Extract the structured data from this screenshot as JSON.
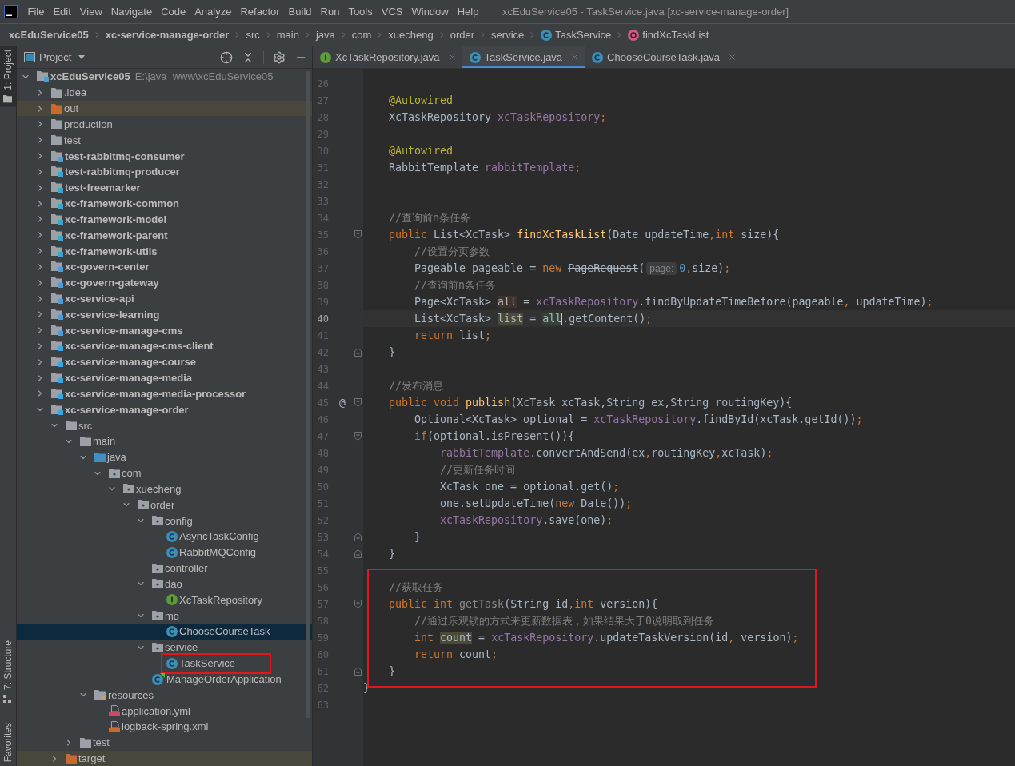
{
  "menu_bar": {
    "items": [
      "File",
      "Edit",
      "View",
      "Navigate",
      "Code",
      "Analyze",
      "Refactor",
      "Build",
      "Run",
      "Tools",
      "VCS",
      "Window",
      "Help"
    ],
    "title": "xcEduService05 - TaskService.java [xc-service-manage-order]"
  },
  "breadcrumbs": [
    {
      "label": "xcEduService05",
      "kind": "module"
    },
    {
      "label": "xc-service-manage-order",
      "kind": "module"
    },
    {
      "label": "src",
      "kind": "folder"
    },
    {
      "label": "main",
      "kind": "folder"
    },
    {
      "label": "java",
      "kind": "folder"
    },
    {
      "label": "com",
      "kind": "folder"
    },
    {
      "label": "xuecheng",
      "kind": "folder"
    },
    {
      "label": "order",
      "kind": "folder"
    },
    {
      "label": "service",
      "kind": "folder"
    },
    {
      "label": "TaskService",
      "kind": "class"
    },
    {
      "label": "findXcTaskList",
      "kind": "method"
    }
  ],
  "tool_stripe": {
    "top": [
      {
        "label": "1: Project",
        "kind": "project",
        "selected": true
      }
    ],
    "bottom": [
      {
        "label": "7: Structure",
        "kind": "structure",
        "selected": false
      },
      {
        "label": "Favorites",
        "kind": "favorites",
        "selected": false
      }
    ]
  },
  "project_panel": {
    "title": "Project",
    "tree": [
      {
        "name": "xcEduService05",
        "path": "E:\\java_www\\xcEduService05",
        "kind": "module",
        "expanded": true,
        "selected": false,
        "boxed": false,
        "children": [
          {
            "name": ".idea",
            "kind": "folder",
            "expanded": false,
            "selected": false,
            "boxed": false
          },
          {
            "name": "out",
            "kind": "excluded",
            "expanded": false,
            "selected": false,
            "boxed": false
          },
          {
            "name": "production",
            "kind": "folder",
            "expanded": false,
            "selected": false,
            "boxed": false
          },
          {
            "name": "test",
            "kind": "folder",
            "expanded": false,
            "selected": false,
            "boxed": false
          },
          {
            "name": "test-rabbitmq-consumer",
            "kind": "module",
            "expanded": false,
            "selected": false,
            "boxed": false
          },
          {
            "name": "test-rabbitmq-producer",
            "kind": "module",
            "expanded": false,
            "selected": false,
            "boxed": false
          },
          {
            "name": "test-freemarker",
            "kind": "module",
            "expanded": false,
            "selected": false,
            "boxed": false
          },
          {
            "name": "xc-framework-common",
            "kind": "module",
            "expanded": false,
            "selected": false,
            "boxed": false
          },
          {
            "name": "xc-framework-model",
            "kind": "module",
            "expanded": false,
            "selected": false,
            "boxed": false
          },
          {
            "name": "xc-framework-parent",
            "kind": "module",
            "expanded": false,
            "selected": false,
            "boxed": false
          },
          {
            "name": "xc-framework-utils",
            "kind": "module",
            "expanded": false,
            "selected": false,
            "boxed": false
          },
          {
            "name": "xc-govern-center",
            "kind": "module",
            "expanded": false,
            "selected": false,
            "boxed": false
          },
          {
            "name": "xc-govern-gateway",
            "kind": "module",
            "expanded": false,
            "selected": false,
            "boxed": false
          },
          {
            "name": "xc-service-api",
            "kind": "module",
            "expanded": false,
            "selected": false,
            "boxed": false
          },
          {
            "name": "xc-service-learning",
            "kind": "module",
            "expanded": false,
            "selected": false,
            "boxed": false
          },
          {
            "name": "xc-service-manage-cms",
            "kind": "module",
            "expanded": false,
            "selected": false,
            "boxed": false
          },
          {
            "name": "xc-service-manage-cms-client",
            "kind": "module",
            "expanded": false,
            "selected": false,
            "boxed": false
          },
          {
            "name": "xc-service-manage-course",
            "kind": "module",
            "expanded": false,
            "selected": false,
            "boxed": false
          },
          {
            "name": "xc-service-manage-media",
            "kind": "module",
            "expanded": false,
            "selected": false,
            "boxed": false
          },
          {
            "name": "xc-service-manage-media-processor",
            "kind": "module",
            "expanded": false,
            "selected": false,
            "boxed": false
          },
          {
            "name": "xc-service-manage-order",
            "kind": "module",
            "expanded": true,
            "selected": false,
            "boxed": false,
            "children": [
              {
                "name": "src",
                "kind": "folder",
                "expanded": true,
                "selected": false,
                "boxed": false,
                "children": [
                  {
                    "name": "main",
                    "kind": "folder",
                    "expanded": true,
                    "selected": false,
                    "boxed": false,
                    "children": [
                      {
                        "name": "java",
                        "kind": "source",
                        "expanded": true,
                        "selected": false,
                        "boxed": false,
                        "children": [
                          {
                            "name": "com",
                            "kind": "package",
                            "expanded": true,
                            "selected": false,
                            "boxed": false,
                            "children": [
                              {
                                "name": "xuecheng",
                                "kind": "package",
                                "expanded": true,
                                "selected": false,
                                "boxed": false,
                                "children": [
                                  {
                                    "name": "order",
                                    "kind": "package",
                                    "expanded": true,
                                    "selected": false,
                                    "boxed": false,
                                    "children": [
                                      {
                                        "name": "config",
                                        "kind": "package",
                                        "expanded": true,
                                        "selected": false,
                                        "boxed": false,
                                        "children": [
                                          {
                                            "name": "AsyncTaskConfig",
                                            "kind": "class",
                                            "selected": false,
                                            "boxed": false
                                          },
                                          {
                                            "name": "RabbitMQConfig",
                                            "kind": "class",
                                            "selected": false,
                                            "boxed": false
                                          }
                                        ]
                                      },
                                      {
                                        "name": "controller",
                                        "kind": "package",
                                        "selected": false,
                                        "boxed": false
                                      },
                                      {
                                        "name": "dao",
                                        "kind": "package",
                                        "expanded": true,
                                        "selected": false,
                                        "boxed": false,
                                        "children": [
                                          {
                                            "name": "XcTaskRepository",
                                            "kind": "interface",
                                            "selected": false,
                                            "boxed": false
                                          }
                                        ]
                                      },
                                      {
                                        "name": "mq",
                                        "kind": "package",
                                        "expanded": true,
                                        "selected": false,
                                        "boxed": false,
                                        "children": [
                                          {
                                            "name": "ChooseCourseTask",
                                            "kind": "class",
                                            "selected": true,
                                            "boxed": false
                                          }
                                        ]
                                      },
                                      {
                                        "name": "service",
                                        "kind": "package",
                                        "expanded": true,
                                        "selected": false,
                                        "boxed": false,
                                        "children": [
                                          {
                                            "name": "TaskService",
                                            "kind": "class",
                                            "selected": false,
                                            "boxed": true
                                          }
                                        ]
                                      },
                                      {
                                        "name": "ManageOrderApplication",
                                        "kind": "app",
                                        "selected": false,
                                        "boxed": false
                                      }
                                    ]
                                  }
                                ]
                              }
                            ]
                          }
                        ]
                      },
                      {
                        "name": "resources",
                        "kind": "resources",
                        "expanded": true,
                        "selected": false,
                        "boxed": false,
                        "children": [
                          {
                            "name": "application.yml",
                            "kind": "yml",
                            "selected": false,
                            "boxed": false
                          },
                          {
                            "name": "logback-spring.xml",
                            "kind": "xml",
                            "selected": false,
                            "boxed": false
                          }
                        ]
                      }
                    ]
                  },
                  {
                    "name": "test",
                    "kind": "folder",
                    "expanded": false,
                    "selected": false,
                    "boxed": false
                  }
                ]
              },
              {
                "name": "target",
                "kind": "excluded",
                "expanded": false,
                "selected": false,
                "boxed": false
              }
            ]
          }
        ]
      }
    ]
  },
  "editor": {
    "tabs": [
      {
        "label": "XcTaskRepository.java",
        "kind": "interface",
        "selected": false
      },
      {
        "label": "TaskService.java",
        "kind": "class",
        "selected": true
      },
      {
        "label": "ChooseCourseTask.java",
        "kind": "class",
        "selected": false
      }
    ],
    "lines": [
      {
        "number": "26",
        "current": false,
        "boxed": false
      },
      {
        "number": "27",
        "current": false,
        "boxed": false,
        "tokens": [
          {
            "text": "    @Autowired",
            "kind": "annotation"
          }
        ]
      },
      {
        "number": "28",
        "current": false,
        "boxed": false,
        "tokens": [
          {
            "text": "    XcTaskRepository ",
            "kind": "plain"
          },
          {
            "text": "xcTaskRepository",
            "kind": "field"
          },
          {
            "text": ";",
            "kind": "keyword"
          }
        ]
      },
      {
        "number": "29",
        "current": false,
        "boxed": false
      },
      {
        "number": "30",
        "current": false,
        "boxed": false,
        "tokens": [
          {
            "text": "    @Autowired",
            "kind": "annotation"
          }
        ]
      },
      {
        "number": "31",
        "current": false,
        "boxed": false,
        "tokens": [
          {
            "text": "    RabbitTemplate ",
            "kind": "plain"
          },
          {
            "text": "rabbitTemplate",
            "kind": "field"
          },
          {
            "text": ";",
            "kind": "keyword"
          }
        ]
      },
      {
        "number": "32",
        "current": false,
        "boxed": false
      },
      {
        "number": "33",
        "current": false,
        "boxed": false
      },
      {
        "number": "34",
        "current": false,
        "boxed": false,
        "tokens": [
          {
            "text": "    //查询前n条任务",
            "kind": "comment"
          }
        ]
      },
      {
        "number": "35",
        "current": false,
        "boxed": false,
        "fold": {
          "kind": "start"
        },
        "tokens": [
          {
            "text": "    public ",
            "kind": "keyword"
          },
          {
            "text": "List<XcTask> ",
            "kind": "plain"
          },
          {
            "text": "findXcTaskList",
            "kind": "method"
          },
          {
            "text": "(Date updateTime",
            "kind": "plain"
          },
          {
            "text": ",int ",
            "kind": "keyword"
          },
          {
            "text": "size){",
            "kind": "plain"
          }
        ]
      },
      {
        "number": "36",
        "current": false,
        "boxed": false,
        "tokens": [
          {
            "text": "        //设置分页参数",
            "kind": "comment"
          }
        ]
      },
      {
        "number": "37",
        "current": false,
        "boxed": false,
        "tokens": [
          {
            "text": "        Pageable pageable = ",
            "kind": "plain"
          },
          {
            "text": "new ",
            "kind": "keyword"
          },
          {
            "text": "PageRequest",
            "kind": "deprecated"
          },
          {
            "text": "(",
            "kind": "plain"
          },
          {
            "text": "page:",
            "kind": "hint"
          },
          {
            "text": "0",
            "kind": "number"
          },
          {
            "text": ",",
            "kind": "keyword"
          },
          {
            "text": "size)",
            "kind": "plain"
          },
          {
            "text": ";",
            "kind": "keyword"
          }
        ]
      },
      {
        "number": "38",
        "current": false,
        "boxed": false,
        "tokens": [
          {
            "text": "        //查询前n条任务",
            "kind": "comment"
          }
        ]
      },
      {
        "number": "39",
        "current": false,
        "boxed": false,
        "tokens": [
          {
            "text": "        Page<XcTask> ",
            "kind": "plain"
          },
          {
            "text": "all",
            "kind": "plain",
            "usage": {
              "kind": "write"
            }
          },
          {
            "text": " = ",
            "kind": "plain"
          },
          {
            "text": "xcTaskRepository",
            "kind": "field"
          },
          {
            "text": ".findByUpdateTimeBefore(pageable",
            "kind": "plain"
          },
          {
            "text": ",",
            "kind": "keyword"
          },
          {
            "text": " updateTime)",
            "kind": "plain"
          },
          {
            "text": ";",
            "kind": "keyword"
          }
        ]
      },
      {
        "number": "40",
        "current": true,
        "boxed": false,
        "tokens": [
          {
            "text": "        List<XcTask> ",
            "kind": "plain"
          },
          {
            "text": "list",
            "kind": "plain",
            "usage": {
              "kind": "warning"
            }
          },
          {
            "text": " = ",
            "kind": "plain"
          },
          {
            "text": "all",
            "kind": "plain",
            "usage": {
              "kind": "read"
            },
            "caret": true
          },
          {
            "text": ".getContent()",
            "kind": "plain"
          },
          {
            "text": ";",
            "kind": "keyword"
          }
        ]
      },
      {
        "number": "41",
        "current": false,
        "boxed": false,
        "tokens": [
          {
            "text": "        return ",
            "kind": "keyword"
          },
          {
            "text": "list",
            "kind": "plain"
          },
          {
            "text": ";",
            "kind": "keyword"
          }
        ]
      },
      {
        "number": "42",
        "current": false,
        "boxed": false,
        "fold": {
          "kind": "end"
        },
        "tokens": [
          {
            "text": "    }",
            "kind": "plain"
          }
        ]
      },
      {
        "number": "43",
        "current": false,
        "boxed": false
      },
      {
        "number": "44",
        "current": false,
        "boxed": false,
        "tokens": [
          {
            "text": "    //发布消息",
            "kind": "comment"
          }
        ]
      },
      {
        "number": "45",
        "current": false,
        "boxed": false,
        "fold": {
          "kind": "start"
        },
        "gutter_mark": "@",
        "tokens": [
          {
            "text": "    public void ",
            "kind": "keyword"
          },
          {
            "text": "publish",
            "kind": "method"
          },
          {
            "text": "(XcTask xcTask,String ex,String routingKey){",
            "kind": "plain"
          }
        ]
      },
      {
        "number": "46",
        "current": false,
        "boxed": false,
        "tokens": [
          {
            "text": "        Optional<XcTask> optional = ",
            "kind": "plain"
          },
          {
            "text": "xcTaskRepository",
            "kind": "field"
          },
          {
            "text": ".findById(xcTask.getId())",
            "kind": "plain"
          },
          {
            "text": ";",
            "kind": "keyword"
          }
        ]
      },
      {
        "number": "47",
        "current": false,
        "boxed": false,
        "fold": {
          "kind": "start"
        },
        "tokens": [
          {
            "text": "        if",
            "kind": "keyword"
          },
          {
            "text": "(optional.isPresent()){",
            "kind": "plain"
          }
        ]
      },
      {
        "number": "48",
        "current": false,
        "boxed": false,
        "tokens": [
          {
            "text": "            rabbitTemplate",
            "kind": "field"
          },
          {
            "text": ".convertAndSend(ex",
            "kind": "plain"
          },
          {
            "text": ",",
            "kind": "keyword"
          },
          {
            "text": "routingKey",
            "kind": "plain"
          },
          {
            "text": ",",
            "kind": "keyword"
          },
          {
            "text": "xcTask)",
            "kind": "plain"
          },
          {
            "text": ";",
            "kind": "keyword"
          }
        ]
      },
      {
        "number": "49",
        "current": false,
        "boxed": false,
        "tokens": [
          {
            "text": "            //更新任务时间",
            "kind": "comment"
          }
        ]
      },
      {
        "number": "50",
        "current": false,
        "boxed": false,
        "tokens": [
          {
            "text": "            XcTask one = optional.get()",
            "kind": "plain"
          },
          {
            "text": ";",
            "kind": "keyword"
          }
        ]
      },
      {
        "number": "51",
        "current": false,
        "boxed": false,
        "tokens": [
          {
            "text": "            one.setUpdateTime(",
            "kind": "plain"
          },
          {
            "text": "new ",
            "kind": "keyword"
          },
          {
            "text": "Date())",
            "kind": "plain"
          },
          {
            "text": ";",
            "kind": "keyword"
          }
        ]
      },
      {
        "number": "52",
        "current": false,
        "boxed": false,
        "tokens": [
          {
            "text": "            xcTaskRepository",
            "kind": "field"
          },
          {
            "text": ".save(one)",
            "kind": "plain"
          },
          {
            "text": ";",
            "kind": "keyword"
          }
        ]
      },
      {
        "number": "53",
        "current": false,
        "boxed": false,
        "fold": {
          "kind": "end"
        },
        "tokens": [
          {
            "text": "        }",
            "kind": "plain"
          }
        ]
      },
      {
        "number": "54",
        "current": false,
        "boxed": false,
        "fold": {
          "kind": "end"
        },
        "tokens": [
          {
            "text": "    }",
            "kind": "plain"
          }
        ]
      },
      {
        "number": "55",
        "current": false,
        "boxed": false
      },
      {
        "number": "56",
        "current": false,
        "boxed": true,
        "tokens": [
          {
            "text": "    //获取任务",
            "kind": "comment"
          }
        ]
      },
      {
        "number": "57",
        "current": false,
        "boxed": true,
        "fold": {
          "kind": "start"
        },
        "tokens": [
          {
            "text": "    public int ",
            "kind": "keyword"
          },
          {
            "text": "getTask",
            "kind": "unused"
          },
          {
            "text": "(String id",
            "kind": "plain"
          },
          {
            "text": ",int ",
            "kind": "keyword"
          },
          {
            "text": "version){",
            "kind": "plain"
          }
        ]
      },
      {
        "number": "58",
        "current": false,
        "boxed": true,
        "tokens": [
          {
            "text": "        //通过乐观锁的方式来更新数据表，如果结果大于0说明取到任务",
            "kind": "comment"
          }
        ]
      },
      {
        "number": "59",
        "current": false,
        "boxed": true,
        "tokens": [
          {
            "text": "        int ",
            "kind": "keyword"
          },
          {
            "text": "count",
            "kind": "plain",
            "usage": {
              "kind": "warning"
            }
          },
          {
            "text": " = ",
            "kind": "plain"
          },
          {
            "text": "xcTaskRepository",
            "kind": "field"
          },
          {
            "text": ".updateTaskVersion(id",
            "kind": "plain"
          },
          {
            "text": ",",
            "kind": "keyword"
          },
          {
            "text": " version)",
            "kind": "plain"
          },
          {
            "text": ";",
            "kind": "keyword"
          }
        ]
      },
      {
        "number": "60",
        "current": false,
        "boxed": true,
        "tokens": [
          {
            "text": "        return ",
            "kind": "keyword"
          },
          {
            "text": "count",
            "kind": "plain"
          },
          {
            "text": ";",
            "kind": "keyword"
          }
        ]
      },
      {
        "number": "61",
        "current": false,
        "boxed": true,
        "fold": {
          "kind": "end"
        },
        "tokens": [
          {
            "text": "    }",
            "kind": "plain"
          }
        ]
      },
      {
        "number": "62",
        "current": false,
        "boxed": false,
        "tokens": [
          {
            "text": "}",
            "kind": "plain"
          }
        ]
      },
      {
        "number": "63",
        "current": false,
        "boxed": false
      }
    ]
  }
}
